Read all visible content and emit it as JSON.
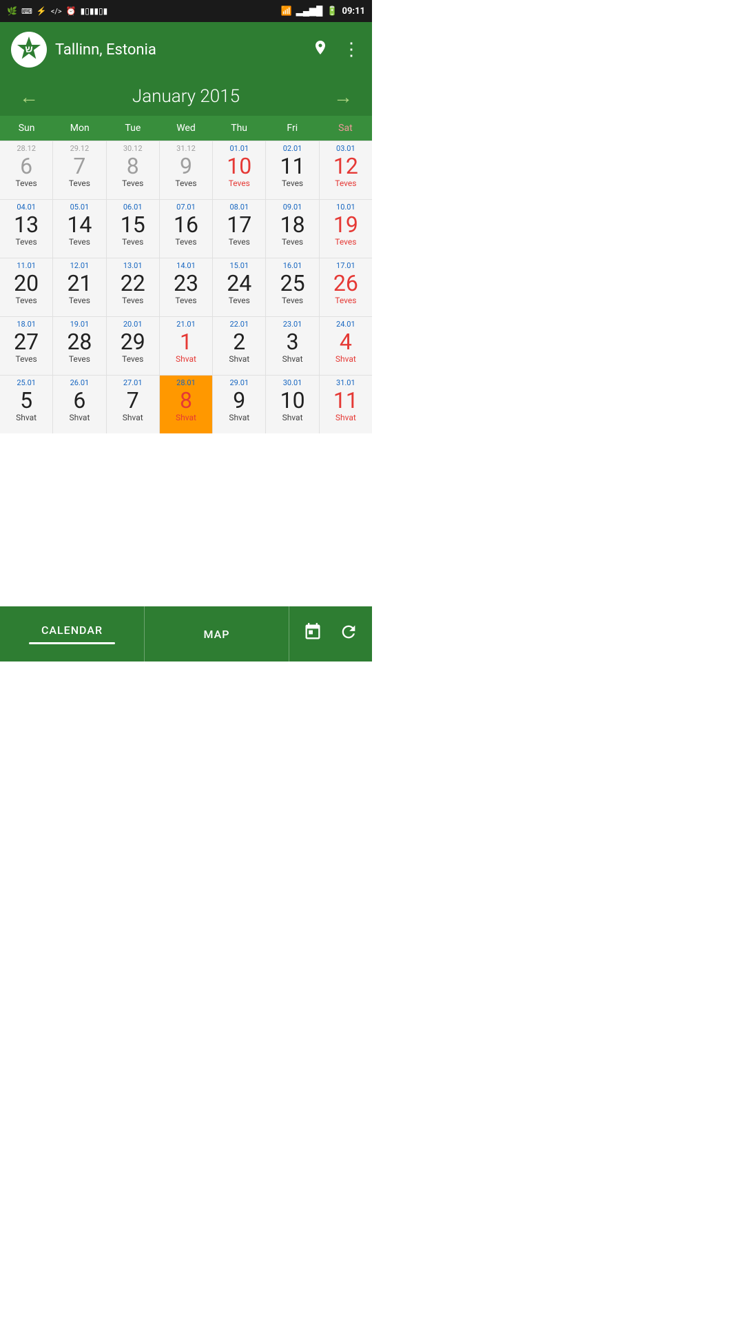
{
  "statusBar": {
    "time": "09:11",
    "icons_left": [
      "leaf-icon",
      "code-icon",
      "usb-icon",
      "brackets-icon",
      "clock-icon",
      "barcode-icon"
    ],
    "icons_right": [
      "wifi-icon",
      "signal-icon",
      "battery-icon"
    ]
  },
  "header": {
    "logo_text": "ש",
    "title": "Tallinn, Estonia",
    "location_icon": "location-icon",
    "menu_icon": "more-icon"
  },
  "navigation": {
    "prev_label": "←",
    "next_label": "→",
    "month_year": "January 2015"
  },
  "dayHeaders": [
    {
      "label": "Sun",
      "weekend": false
    },
    {
      "label": "Mon",
      "weekend": false
    },
    {
      "label": "Tue",
      "weekend": false
    },
    {
      "label": "Wed",
      "weekend": false
    },
    {
      "label": "Thu",
      "weekend": false
    },
    {
      "label": "Fri",
      "weekend": false
    },
    {
      "label": "Sat",
      "weekend": true
    }
  ],
  "weeks": [
    {
      "days": [
        {
          "greg": "28.12",
          "date": "6",
          "hebrew": "Teves",
          "gregClass": "prev",
          "dateClass": "gray",
          "hebClass": "normal",
          "today": false
        },
        {
          "greg": "29.12",
          "date": "7",
          "hebrew": "Teves",
          "gregClass": "prev",
          "dateClass": "gray",
          "hebClass": "normal",
          "today": false
        },
        {
          "greg": "30.12",
          "date": "8",
          "hebrew": "Teves",
          "gregClass": "prev",
          "dateClass": "gray",
          "hebClass": "normal",
          "today": false
        },
        {
          "greg": "31.12",
          "date": "9",
          "hebrew": "Teves",
          "gregClass": "prev",
          "dateClass": "gray",
          "hebClass": "normal",
          "today": false
        },
        {
          "greg": "01.01",
          "date": "10",
          "hebrew": "Teves",
          "gregClass": "normal",
          "dateClass": "red",
          "hebClass": "red",
          "today": false
        },
        {
          "greg": "02.01",
          "date": "11",
          "hebrew": "Teves",
          "gregClass": "normal",
          "dateClass": "normal",
          "hebClass": "normal",
          "today": false
        },
        {
          "greg": "03.01",
          "date": "12",
          "hebrew": "Teves",
          "gregClass": "normal",
          "dateClass": "red",
          "hebClass": "red",
          "today": false
        }
      ]
    },
    {
      "days": [
        {
          "greg": "04.01",
          "date": "13",
          "hebrew": "Teves",
          "gregClass": "normal",
          "dateClass": "normal",
          "hebClass": "normal",
          "today": false
        },
        {
          "greg": "05.01",
          "date": "14",
          "hebrew": "Teves",
          "gregClass": "normal",
          "dateClass": "normal",
          "hebClass": "normal",
          "today": false
        },
        {
          "greg": "06.01",
          "date": "15",
          "hebrew": "Teves",
          "gregClass": "normal",
          "dateClass": "normal",
          "hebClass": "normal",
          "today": false
        },
        {
          "greg": "07.01",
          "date": "16",
          "hebrew": "Teves",
          "gregClass": "normal",
          "dateClass": "normal",
          "hebClass": "normal",
          "today": false
        },
        {
          "greg": "08.01",
          "date": "17",
          "hebrew": "Teves",
          "gregClass": "normal",
          "dateClass": "normal",
          "hebClass": "normal",
          "today": false
        },
        {
          "greg": "09.01",
          "date": "18",
          "hebrew": "Teves",
          "gregClass": "normal",
          "dateClass": "normal",
          "hebClass": "normal",
          "today": false
        },
        {
          "greg": "10.01",
          "date": "19",
          "hebrew": "Teves",
          "gregClass": "normal",
          "dateClass": "red",
          "hebClass": "red",
          "today": false
        }
      ]
    },
    {
      "days": [
        {
          "greg": "11.01",
          "date": "20",
          "hebrew": "Teves",
          "gregClass": "normal",
          "dateClass": "normal",
          "hebClass": "normal",
          "today": false
        },
        {
          "greg": "12.01",
          "date": "21",
          "hebrew": "Teves",
          "gregClass": "normal",
          "dateClass": "normal",
          "hebClass": "normal",
          "today": false
        },
        {
          "greg": "13.01",
          "date": "22",
          "hebrew": "Teves",
          "gregClass": "normal",
          "dateClass": "normal",
          "hebClass": "normal",
          "today": false
        },
        {
          "greg": "14.01",
          "date": "23",
          "hebrew": "Teves",
          "gregClass": "normal",
          "dateClass": "normal",
          "hebClass": "normal",
          "today": false
        },
        {
          "greg": "15.01",
          "date": "24",
          "hebrew": "Teves",
          "gregClass": "normal",
          "dateClass": "normal",
          "hebClass": "normal",
          "today": false
        },
        {
          "greg": "16.01",
          "date": "25",
          "hebrew": "Teves",
          "gregClass": "normal",
          "dateClass": "normal",
          "hebClass": "normal",
          "today": false
        },
        {
          "greg": "17.01",
          "date": "26",
          "hebrew": "Teves",
          "gregClass": "normal",
          "dateClass": "red",
          "hebClass": "red",
          "today": false
        }
      ]
    },
    {
      "days": [
        {
          "greg": "18.01",
          "date": "27",
          "hebrew": "Teves",
          "gregClass": "normal",
          "dateClass": "normal",
          "hebClass": "normal",
          "today": false
        },
        {
          "greg": "19.01",
          "date": "28",
          "hebrew": "Teves",
          "gregClass": "normal",
          "dateClass": "normal",
          "hebClass": "normal",
          "today": false
        },
        {
          "greg": "20.01",
          "date": "29",
          "hebrew": "Teves",
          "gregClass": "normal",
          "dateClass": "normal",
          "hebClass": "normal",
          "today": false
        },
        {
          "greg": "21.01",
          "date": "1",
          "hebrew": "Shvat",
          "gregClass": "normal",
          "dateClass": "red",
          "hebClass": "red",
          "today": false
        },
        {
          "greg": "22.01",
          "date": "2",
          "hebrew": "Shvat",
          "gregClass": "normal",
          "dateClass": "normal",
          "hebClass": "normal",
          "today": false
        },
        {
          "greg": "23.01",
          "date": "3",
          "hebrew": "Shvat",
          "gregClass": "normal",
          "dateClass": "normal",
          "hebClass": "normal",
          "today": false
        },
        {
          "greg": "24.01",
          "date": "4",
          "hebrew": "Shvat",
          "gregClass": "normal",
          "dateClass": "red",
          "hebClass": "red",
          "today": false
        }
      ]
    },
    {
      "days": [
        {
          "greg": "25.01",
          "date": "5",
          "hebrew": "Shvat",
          "gregClass": "normal",
          "dateClass": "normal",
          "hebClass": "normal",
          "today": false
        },
        {
          "greg": "26.01",
          "date": "6",
          "hebrew": "Shvat",
          "gregClass": "normal",
          "dateClass": "normal",
          "hebClass": "normal",
          "today": false
        },
        {
          "greg": "27.01",
          "date": "7",
          "hebrew": "Shvat",
          "gregClass": "normal",
          "dateClass": "normal",
          "hebClass": "normal",
          "today": false
        },
        {
          "greg": "28.01",
          "date": "8",
          "hebrew": "Shvat",
          "gregClass": "normal",
          "dateClass": "today",
          "hebClass": "today",
          "today": true
        },
        {
          "greg": "29.01",
          "date": "9",
          "hebrew": "Shvat",
          "gregClass": "normal",
          "dateClass": "normal",
          "hebClass": "normal",
          "today": false
        },
        {
          "greg": "30.01",
          "date": "10",
          "hebrew": "Shvat",
          "gregClass": "normal",
          "dateClass": "normal",
          "hebClass": "normal",
          "today": false
        },
        {
          "greg": "31.01",
          "date": "11",
          "hebrew": "Shvat",
          "gregClass": "normal",
          "dateClass": "red",
          "hebClass": "red",
          "today": false
        }
      ]
    }
  ],
  "bottomNav": {
    "tabs": [
      {
        "label": "CALENDAR",
        "active": true
      },
      {
        "label": "MAP",
        "active": false
      }
    ],
    "actions": [
      {
        "icon": "calendar-icon"
      },
      {
        "icon": "refresh-icon"
      }
    ]
  },
  "colors": {
    "green_dark": "#1b5e20",
    "green_medium": "#2e7d32",
    "green_light": "#388e3c",
    "today_orange": "#ff9800",
    "red": "#e53935",
    "blue": "#1565c0",
    "gray": "#9e9e9e"
  }
}
